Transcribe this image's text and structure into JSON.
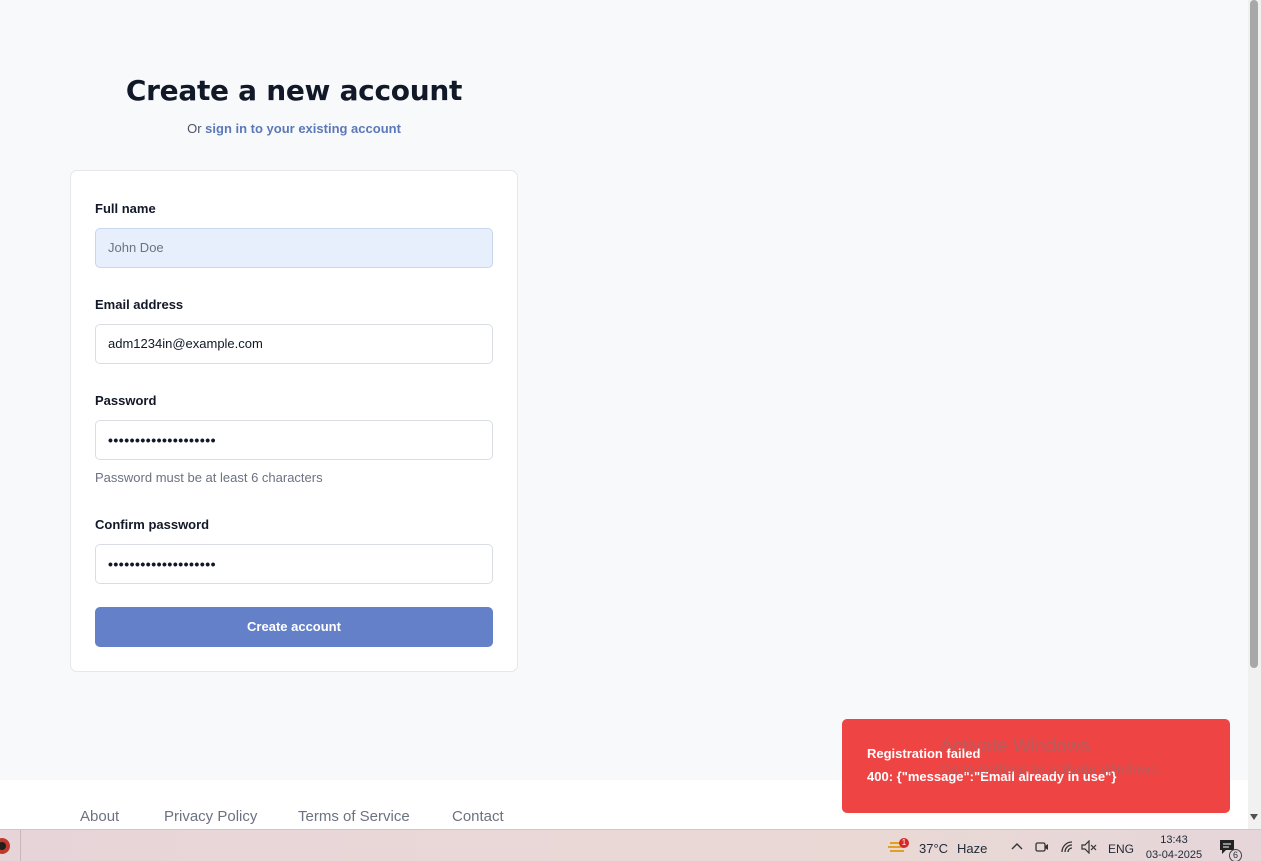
{
  "header": {
    "title": "Create a new account",
    "subtitle_prefix": "Or",
    "signin_link": "sign in to your existing account"
  },
  "form": {
    "full_name_label": "Full name",
    "full_name_placeholder": "John Doe",
    "email_label": "Email address",
    "email_value": "adm1234in@example.com",
    "password_label": "Password",
    "password_value": "••••••••••••••••••••",
    "password_hint": "Password must be at least 6 characters",
    "confirm_label": "Confirm password",
    "confirm_value": "••••••••••••••••••••",
    "submit_label": "Create account"
  },
  "footer": {
    "links": [
      "About",
      "Privacy Policy",
      "Terms of Service",
      "Contact"
    ]
  },
  "toast": {
    "title": "Registration failed",
    "message": "400: {\"message\":\"Email already in use\"}",
    "color": "#ef4444"
  },
  "watermark": {
    "line1": "Activate Windows",
    "line2": "Go to Settings to activate Windows."
  },
  "taskbar": {
    "weather_badge": "1",
    "temperature": "37°C",
    "condition": "Haze",
    "language": "ENG",
    "time": "13:43",
    "date": "03-04-2025",
    "notifications": "6"
  },
  "colors": {
    "accent": "#6480c8",
    "link": "#5b79b8",
    "autofill_bg": "#e8effc"
  }
}
